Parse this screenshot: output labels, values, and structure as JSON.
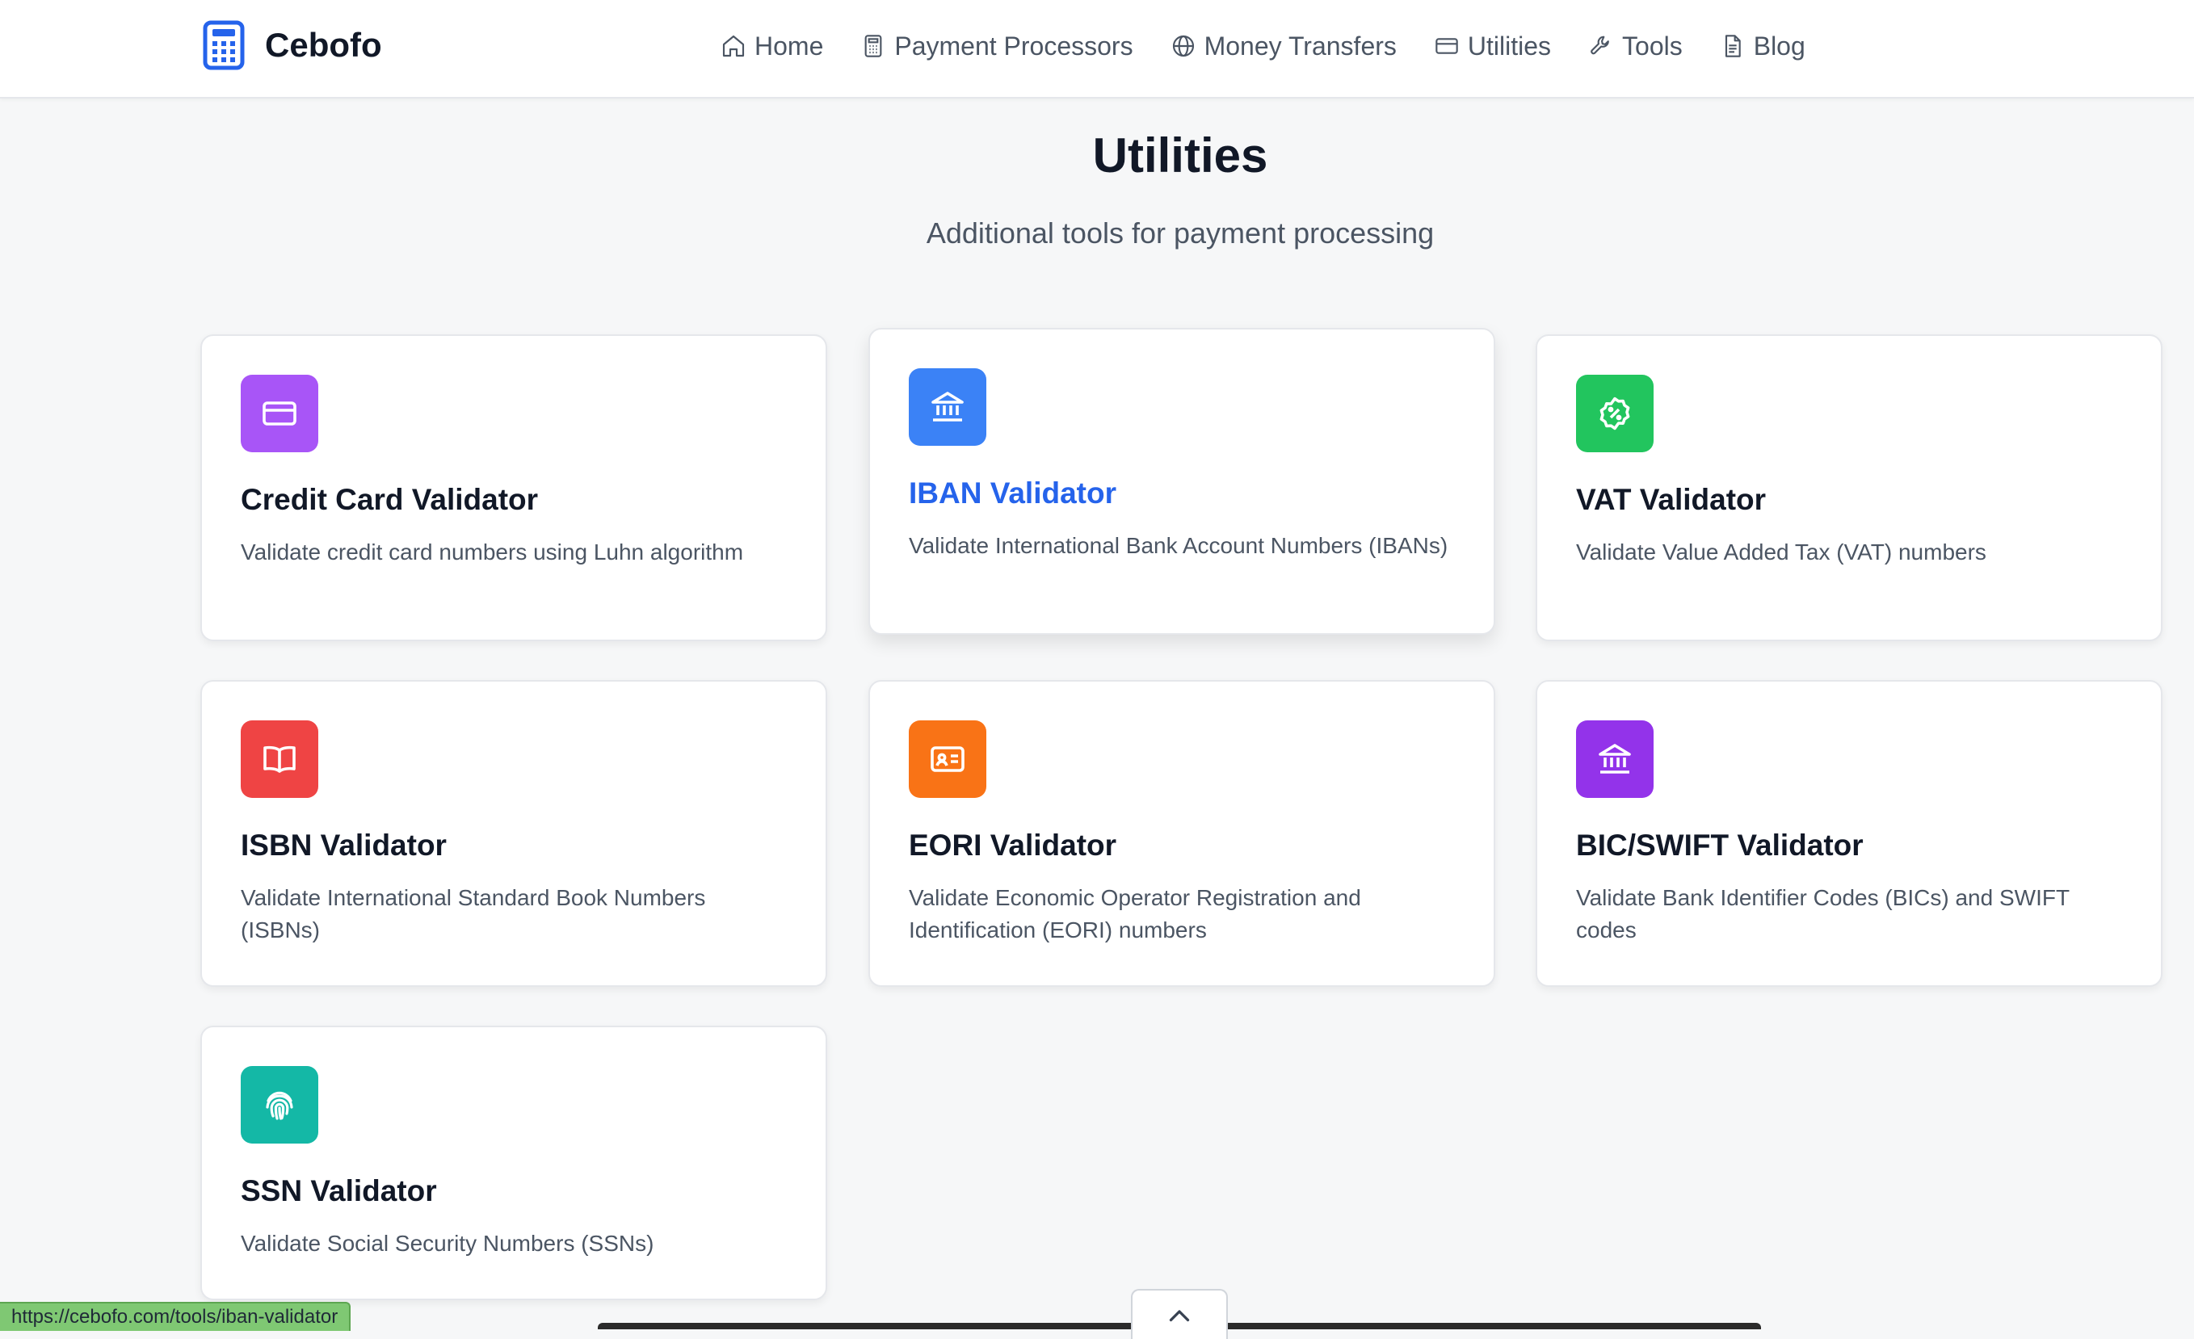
{
  "header": {
    "brand": "Cebofo",
    "nav": [
      {
        "label": "Home",
        "icon": "home-icon"
      },
      {
        "label": "Payment Processors",
        "icon": "calculator-icon"
      },
      {
        "label": "Money Transfers",
        "icon": "globe-icon"
      },
      {
        "label": "Utilities",
        "icon": "credit-card-icon"
      },
      {
        "label": "Tools",
        "icon": "wrench-icon"
      },
      {
        "label": "Blog",
        "icon": "document-icon"
      }
    ]
  },
  "page": {
    "title": "Utilities",
    "subtitle": "Additional tools for payment processing"
  },
  "cards": [
    {
      "title": "Credit Card Validator",
      "description": "Validate credit card numbers using Luhn algorithm",
      "icon": "credit-card-icon",
      "color": "#a855f7"
    },
    {
      "title": "IBAN Validator",
      "description": "Validate International Bank Account Numbers (IBANs)",
      "icon": "bank-icon",
      "color": "#3b82f6"
    },
    {
      "title": "VAT Validator",
      "description": "Validate Value Added Tax (VAT) numbers",
      "icon": "percent-badge-icon",
      "color": "#22c55e"
    },
    {
      "title": "ISBN Validator",
      "description": "Validate International Standard Book Numbers (ISBNs)",
      "icon": "book-icon",
      "color": "#ef4444"
    },
    {
      "title": "EORI Validator",
      "description": "Validate Economic Operator Registration and Identification (EORI) numbers",
      "icon": "id-card-icon",
      "color": "#f97316"
    },
    {
      "title": "BIC/SWIFT Validator",
      "description": "Validate Bank Identifier Codes (BICs) and SWIFT codes",
      "icon": "bank-icon",
      "color": "#9333ea"
    },
    {
      "title": "SSN Validator",
      "description": "Validate Social Security Numbers (SSNs)",
      "icon": "fingerprint-icon",
      "color": "#14b8a6"
    }
  ],
  "status_bar": {
    "url": "https://cebofo.com/tools/iban-validator"
  }
}
